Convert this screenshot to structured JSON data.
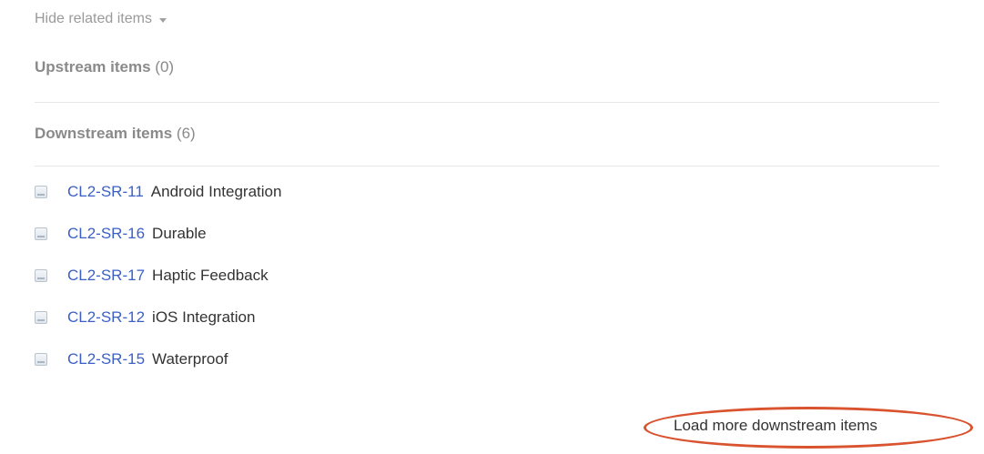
{
  "related": {
    "toggle_label": "Hide related items",
    "toggle_icon": "caret-down-icon"
  },
  "upstream": {
    "title": "Upstream items",
    "count": "(0)"
  },
  "downstream": {
    "title": "Downstream items",
    "count": "(6)",
    "items": [
      {
        "id": "CL2-SR-11",
        "title": "Android Integration",
        "icon": "document-icon"
      },
      {
        "id": "CL2-SR-16",
        "title": "Durable",
        "icon": "document-icon"
      },
      {
        "id": "CL2-SR-17",
        "title": "Haptic Feedback",
        "icon": "document-icon"
      },
      {
        "id": "CL2-SR-12",
        "title": "iOS Integration",
        "icon": "document-icon"
      },
      {
        "id": "CL2-SR-15",
        "title": "Waterproof",
        "icon": "document-icon"
      }
    ],
    "load_more_label": "Load more downstream items"
  },
  "colors": {
    "link": "#3b5fc5",
    "annotation_ring": "#d9532f"
  }
}
